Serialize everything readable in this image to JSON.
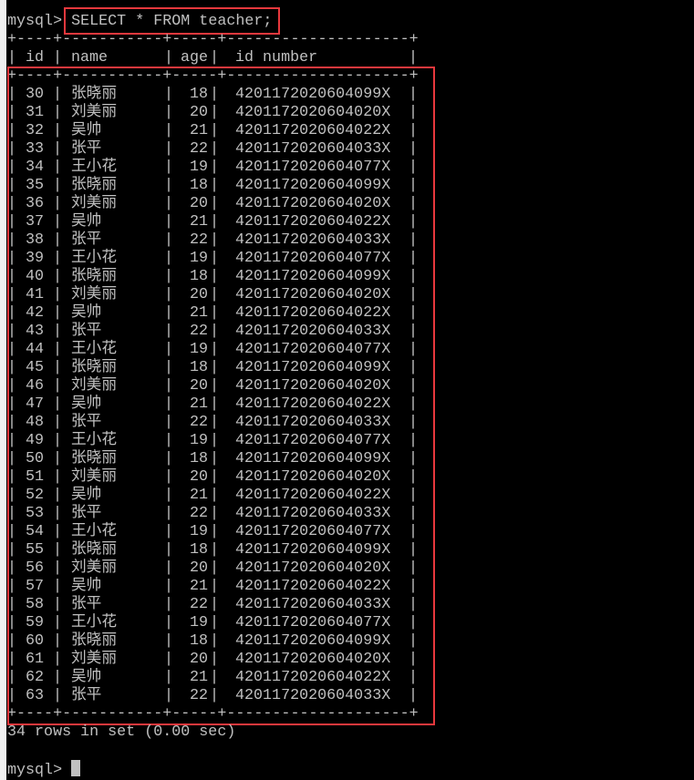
{
  "terminal": {
    "prompt": "mysql>",
    "command": "SELECT * FROM teacher;",
    "border": "+----+-----------+-----+--------------------+",
    "columns": [
      "id",
      "name",
      "age",
      "id number"
    ],
    "rows": [
      [
        "30",
        "张晓丽",
        "18",
        "4201172020604099X"
      ],
      [
        "31",
        "刘美丽",
        "20",
        "4201172020604020X"
      ],
      [
        "32",
        "吴帅",
        "21",
        "4201172020604022X"
      ],
      [
        "33",
        "张平",
        "22",
        "4201172020604033X"
      ],
      [
        "34",
        "王小花",
        "19",
        "4201172020604077X"
      ],
      [
        "35",
        "张晓丽",
        "18",
        "4201172020604099X"
      ],
      [
        "36",
        "刘美丽",
        "20",
        "4201172020604020X"
      ],
      [
        "37",
        "吴帅",
        "21",
        "4201172020604022X"
      ],
      [
        "38",
        "张平",
        "22",
        "4201172020604033X"
      ],
      [
        "39",
        "王小花",
        "19",
        "4201172020604077X"
      ],
      [
        "40",
        "张晓丽",
        "18",
        "4201172020604099X"
      ],
      [
        "41",
        "刘美丽",
        "20",
        "4201172020604020X"
      ],
      [
        "42",
        "吴帅",
        "21",
        "4201172020604022X"
      ],
      [
        "43",
        "张平",
        "22",
        "4201172020604033X"
      ],
      [
        "44",
        "王小花",
        "19",
        "4201172020604077X"
      ],
      [
        "45",
        "张晓丽",
        "18",
        "4201172020604099X"
      ],
      [
        "46",
        "刘美丽",
        "20",
        "4201172020604020X"
      ],
      [
        "47",
        "吴帅",
        "21",
        "4201172020604022X"
      ],
      [
        "48",
        "张平",
        "22",
        "4201172020604033X"
      ],
      [
        "49",
        "王小花",
        "19",
        "4201172020604077X"
      ],
      [
        "50",
        "张晓丽",
        "18",
        "4201172020604099X"
      ],
      [
        "51",
        "刘美丽",
        "20",
        "4201172020604020X"
      ],
      [
        "52",
        "吴帅",
        "21",
        "4201172020604022X"
      ],
      [
        "53",
        "张平",
        "22",
        "4201172020604033X"
      ],
      [
        "54",
        "王小花",
        "19",
        "4201172020604077X"
      ],
      [
        "55",
        "张晓丽",
        "18",
        "4201172020604099X"
      ],
      [
        "56",
        "刘美丽",
        "20",
        "4201172020604020X"
      ],
      [
        "57",
        "吴帅",
        "21",
        "4201172020604022X"
      ],
      [
        "58",
        "张平",
        "22",
        "4201172020604033X"
      ],
      [
        "59",
        "王小花",
        "19",
        "4201172020604077X"
      ],
      [
        "60",
        "张晓丽",
        "18",
        "4201172020604099X"
      ],
      [
        "61",
        "刘美丽",
        "20",
        "4201172020604020X"
      ],
      [
        "62",
        "吴帅",
        "21",
        "4201172020604022X"
      ],
      [
        "63",
        "张平",
        "22",
        "4201172020604033X"
      ]
    ],
    "summary": "34 rows in set (0.00 sec)",
    "prompt2": "mysql>",
    "highlight_color": "#e8383d"
  }
}
